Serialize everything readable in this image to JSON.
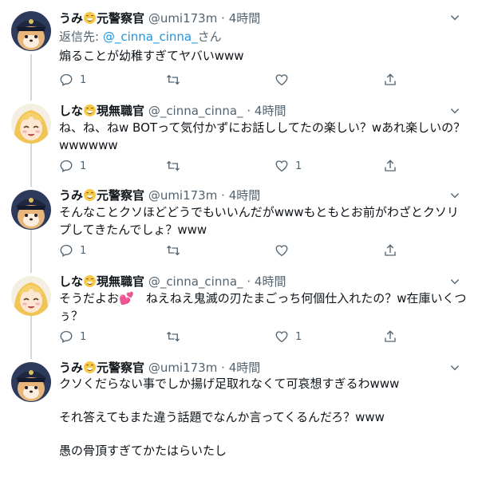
{
  "colors": {
    "link": "#1b95e0",
    "secondary": "#536471",
    "separator": "#e6ecf0",
    "text": "#0f1419"
  },
  "tweets": [
    {
      "name": "うみ",
      "name_suffix": "元警察官",
      "handle": "@umi173m",
      "dot": "·",
      "time": "4時間",
      "reply_prefix": "返信先: ",
      "reply_handle": "@_cinna_cinna_",
      "reply_suffix": "さん",
      "text": "煽ることが幼稚すぎてヤバいwww",
      "reply_count": "1",
      "retweet_count": "",
      "like_count": "",
      "avatar": "umi-avatar"
    },
    {
      "name": "しな",
      "name_suffix": "現無職官",
      "handle": "@_cinna_cinna_",
      "dot": "·",
      "time": "4時間",
      "text": "ね、ね、ねw BOTって気付かずにお話ししてたの楽しい？wあれ楽しいの？wwwwww",
      "reply_count": "1",
      "retweet_count": "",
      "like_count": "1",
      "avatar": "cinna-avatar"
    },
    {
      "name": "うみ",
      "name_suffix": "元警察官",
      "handle": "@umi173m",
      "dot": "·",
      "time": "4時間",
      "text": "そんなことクソほどどうでもいいんだがwwwもともとお前がわざとクソリプしてきたんでしょ？www",
      "reply_count": "1",
      "retweet_count": "",
      "like_count": "",
      "avatar": "umi-avatar"
    },
    {
      "name": "しな",
      "name_suffix": "現無職官",
      "handle": "@_cinna_cinna_",
      "dot": "·",
      "time": "4時間",
      "text_before_emoji": "そうだよお",
      "heart": "💕",
      "text_after_emoji": "　ねえねえ鬼滅の刃たまごっち何個仕入れたの？w在庫いくつぅ？",
      "reply_count": "1",
      "retweet_count": "",
      "like_count": "1",
      "avatar": "cinna-avatar"
    },
    {
      "name": "うみ",
      "name_suffix": "元警察官",
      "handle": "@umi173m",
      "dot": "·",
      "time": "4時間",
      "text": "クソくだらない事でしか揚げ足取れなくて可哀想すぎるわwww\n\nそれ答えてもまた違う話題でなんか言ってくるんだろ？www\n\n愚の骨頂すぎてかたはらいたし",
      "avatar": "umi-avatar"
    }
  ]
}
